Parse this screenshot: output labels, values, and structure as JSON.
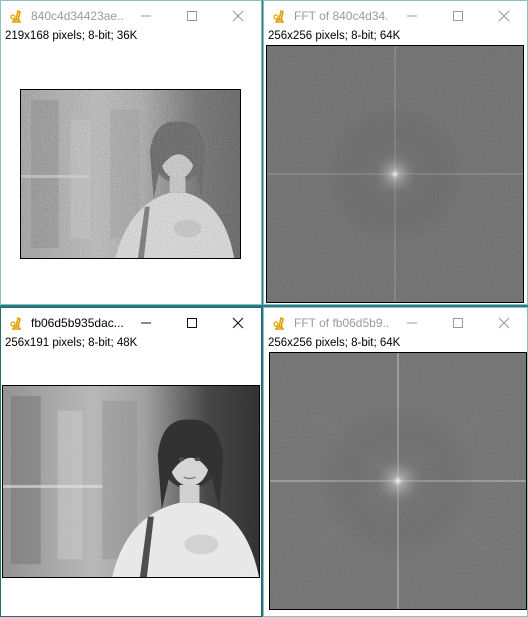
{
  "windows": [
    {
      "title": "840c4d34423ae...",
      "info": "219x168 pixels; 8-bit; 36K",
      "image": "grainy-portrait-photo",
      "active": false
    },
    {
      "title": "FFT of 840c4d34...",
      "info": "256x256 pixels; 8-bit; 64K",
      "image": "fft-spectrum",
      "active": false
    },
    {
      "title": "fb06d5b935dac...",
      "info": "256x191 pixels; 8-bit; 48K",
      "image": "portrait-photo",
      "active": true
    },
    {
      "title": "FFT of fb06d5b9...",
      "info": "256x256 pixels; 8-bit; 64K",
      "image": "fft-spectrum",
      "active": false
    }
  ],
  "icons": {
    "app": "imagej-microscope-icon",
    "minimize": "minimize-icon",
    "maximize": "maximize-icon",
    "close": "close-icon"
  },
  "colors": {
    "desktop": "#2a7a7f",
    "window_bg": "#ffffff",
    "icon_accent": "#e0a000"
  }
}
